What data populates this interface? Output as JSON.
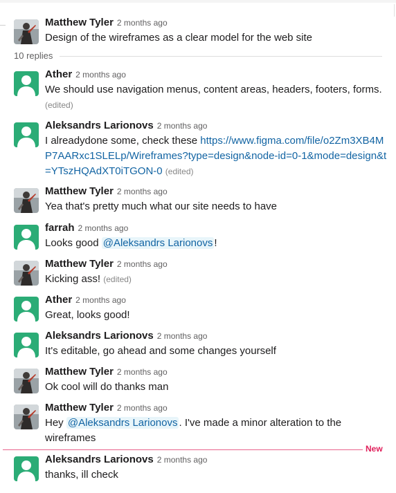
{
  "parent": {
    "author": "Matthew Tyler",
    "time": "2 months ago",
    "text": "Design of the wireframes as a clear model for the web site"
  },
  "replies_label": "10 replies",
  "new_label": "New",
  "edited_label": "(edited)",
  "messages": [
    {
      "author": "Ather",
      "time": "2 months ago",
      "text": "We should use navigation menus, content areas, headers, footers, forms."
    },
    {
      "author": "Aleksandrs Larionovs",
      "time": "2 months ago",
      "text_before": "I alreadydone some, check these ",
      "link": "https://www.figma.com/file/o2Zm3XB4MP7AARxc1SLELp/Wireframes?type=design&node-id=0-1&mode=design&t=YTszHQAdXT0iTGON-0"
    },
    {
      "author": "Matthew Tyler",
      "time": "2 months ago",
      "text": "Yea that's pretty much what our site needs to have"
    },
    {
      "author": "farrah",
      "time": "2 months ago",
      "text_before": "Looks good ",
      "mention": "@Aleksandrs Larionovs",
      "text_after": "!"
    },
    {
      "author": "Matthew Tyler",
      "time": "2 months ago",
      "text": "Kicking ass!"
    },
    {
      "author": "Ather",
      "time": "2 months ago",
      "text": "Great, looks good!"
    },
    {
      "author": "Aleksandrs Larionovs",
      "time": "2 months ago",
      "text": "It's editable, go ahead and some changes yourself"
    },
    {
      "author": "Matthew Tyler",
      "time": "2 months ago",
      "text": "Ok cool will do thanks man"
    },
    {
      "author": "Matthew Tyler",
      "time": "2 months ago",
      "text_before": "Hey ",
      "mention": "@Aleksandrs Larionovs",
      "text_after": ". I've made a minor alteration to the wireframes"
    },
    {
      "author": "Aleksandrs Larionovs",
      "time": "2 months ago",
      "text": "thanks, ill check"
    }
  ],
  "colors": {
    "link": "#1264a3",
    "new_divider": "#e01e5a",
    "default_avatar": "#2bac76"
  },
  "icons": {
    "default_avatar": "user-silhouette-icon",
    "photo_avatar": "warrior-portrait-icon"
  }
}
